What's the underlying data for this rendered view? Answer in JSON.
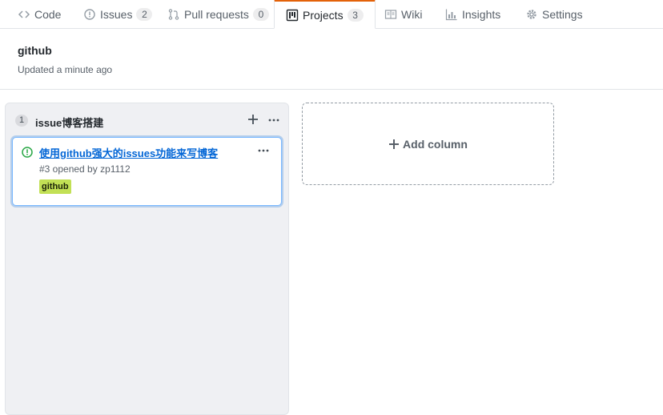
{
  "tabs": [
    {
      "label": "Code",
      "icon": "code-icon"
    },
    {
      "label": "Issues",
      "icon": "issue-opened-icon",
      "count": "2"
    },
    {
      "label": "Pull requests",
      "icon": "git-pull-request-icon",
      "count": "0"
    },
    {
      "label": "Projects",
      "icon": "project-icon",
      "count": "3",
      "selected": true
    },
    {
      "label": "Wiki",
      "icon": "book-icon"
    },
    {
      "label": "Insights",
      "icon": "graph-icon"
    },
    {
      "label": "Settings",
      "icon": "gear-icon"
    }
  ],
  "project": {
    "title": "github",
    "updated": "Updated a minute ago"
  },
  "column": {
    "count": "1",
    "name": "issue博客搭建",
    "cards": [
      {
        "title": "使用github强大的issues功能来写博客",
        "meta": "#3 opened by zp1112",
        "label": "github",
        "label_color": "#c2e055",
        "status_icon": "issue-opened-icon"
      }
    ]
  },
  "add_column": {
    "label": "Add column"
  },
  "colors": {
    "tab_accent": "#e36209",
    "link": "#0366d6",
    "issue_open": "#28a745",
    "card_focus": "#79b8ff"
  }
}
